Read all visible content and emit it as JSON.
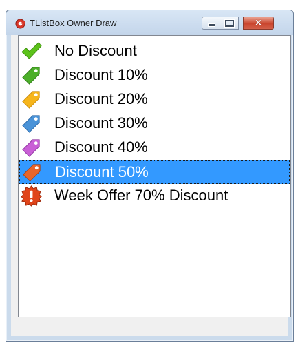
{
  "window": {
    "title": "TListBox Owner Draw",
    "buttons": {
      "minimize": "minimize",
      "maximize": "maximize",
      "close": "×"
    }
  },
  "listbox": {
    "items": [
      {
        "label": "No Discount",
        "icon": "green-checkmark-icon",
        "color": "#5cc21a"
      },
      {
        "label": "Discount 10%",
        "icon": "green-tag-icon",
        "color": "#4caf2a"
      },
      {
        "label": "Discount 20%",
        "icon": "yellow-tag-icon",
        "color": "#f6b51b"
      },
      {
        "label": "Discount 30%",
        "icon": "blue-tag-icon",
        "color": "#4a93d8"
      },
      {
        "label": "Discount 40%",
        "icon": "purple-tag-icon",
        "color": "#c95fd6"
      },
      {
        "label": "Discount 50%",
        "icon": "orange-tag-icon",
        "color": "#e8652a",
        "selected": true
      },
      {
        "label": "Week Offer 70% Discount",
        "icon": "exclamation-badge-icon",
        "color": "#e0441a"
      }
    ],
    "selection_color": "#3399ff"
  }
}
